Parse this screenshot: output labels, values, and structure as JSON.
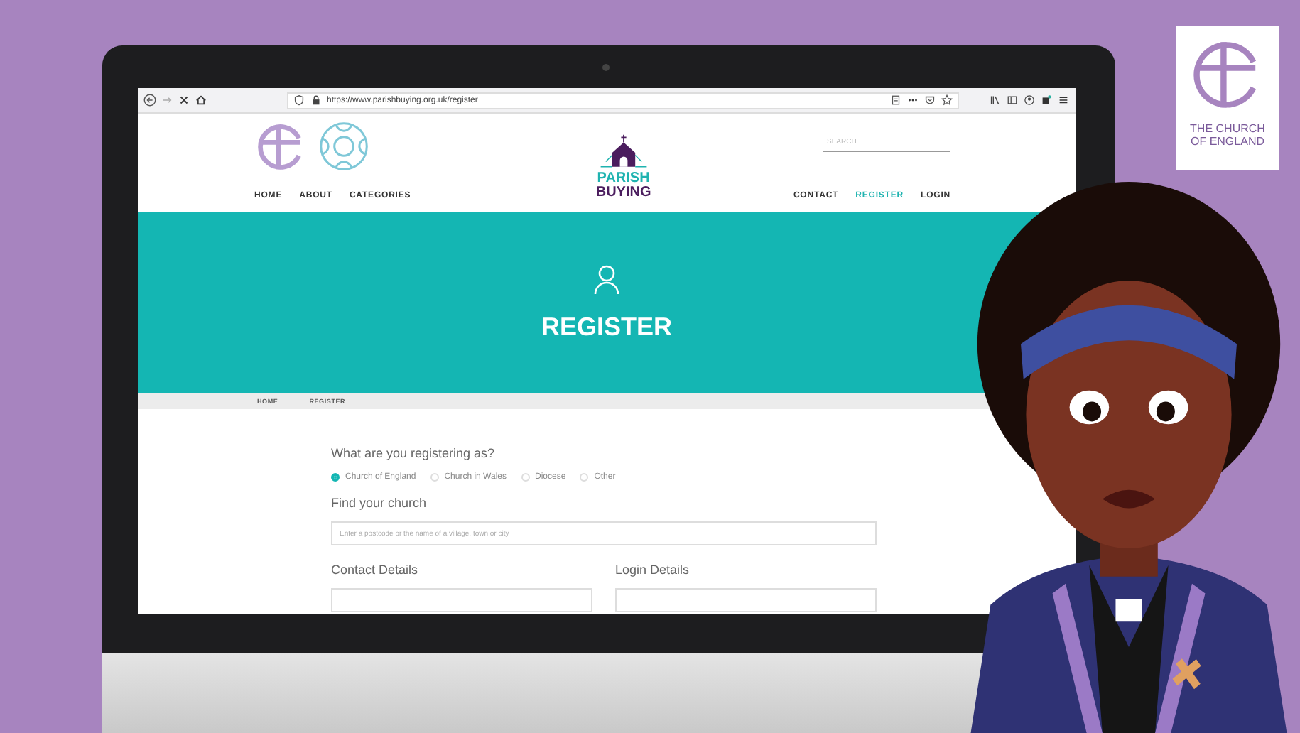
{
  "browser": {
    "url": "https://www.parishbuying.org.uk/register"
  },
  "site_header": {
    "logo_lines": [
      "PARISH",
      "BUYING"
    ],
    "search": {
      "placeholder": "SEARCH..."
    },
    "nav_left": [
      {
        "label": "HOME",
        "selected": false
      },
      {
        "label": "ABOUT",
        "selected": false
      },
      {
        "label": "CATEGORIES",
        "selected": false
      }
    ],
    "nav_right": [
      {
        "label": "CONTACT",
        "selected": false
      },
      {
        "label": "REGISTER",
        "selected": true
      },
      {
        "label": "LOGIN",
        "selected": false
      }
    ]
  },
  "hero": {
    "title": "REGISTER"
  },
  "breadcrumb": [
    "HOME",
    "REGISTER"
  ],
  "form": {
    "question": "What are you registering as?",
    "options": [
      {
        "label": "Church of England",
        "selected": true
      },
      {
        "label": "Church in Wales",
        "selected": false
      },
      {
        "label": "Diocese",
        "selected": false
      },
      {
        "label": "Other",
        "selected": false
      }
    ],
    "find_label": "Find your church",
    "find_field": {
      "placeholder": "Enter a postcode or the name of a village, town or city"
    },
    "sections": [
      "Contact Details",
      "Login Details"
    ]
  },
  "corner_logo": {
    "lines": [
      "THE CHURCH",
      "OF ENGLAND"
    ]
  }
}
